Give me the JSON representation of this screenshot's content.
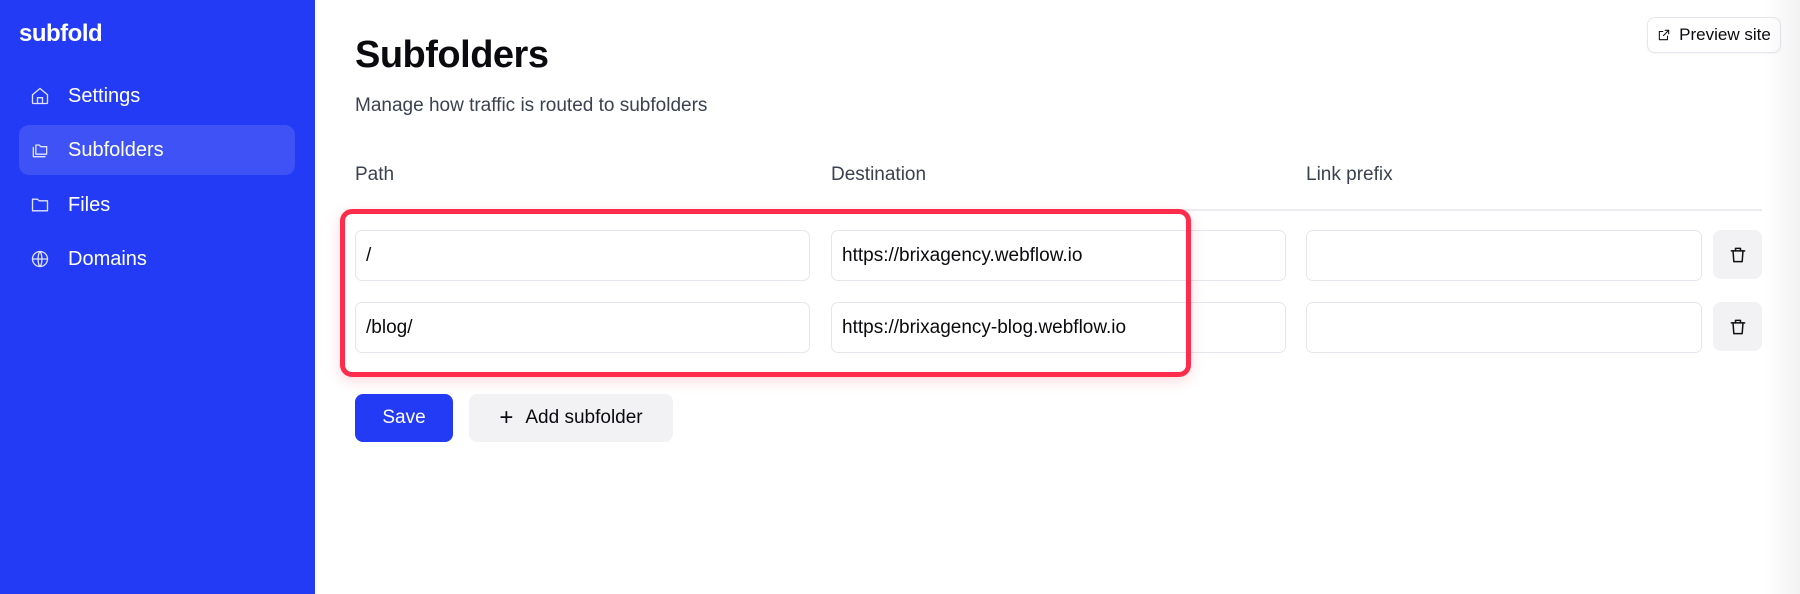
{
  "app": {
    "logo": "subfold"
  },
  "sidebar": {
    "items": [
      {
        "label": "Settings",
        "icon": "home-icon",
        "active": false
      },
      {
        "label": "Subfolders",
        "icon": "folders-icon",
        "active": true
      },
      {
        "label": "Files",
        "icon": "folder-icon",
        "active": false
      },
      {
        "label": "Domains",
        "icon": "globe-icon",
        "active": false
      }
    ]
  },
  "header": {
    "title": "Subfolders",
    "subtitle": "Manage how traffic is routed to subfolders",
    "preview_label": "Preview site"
  },
  "table": {
    "columns": [
      "Path",
      "Destination",
      "Link prefix"
    ],
    "rows": [
      {
        "path": "/",
        "destination": "https://brixagency.webflow.io",
        "link_prefix": ""
      },
      {
        "path": "/blog/",
        "destination": "https://brixagency-blog.webflow.io",
        "link_prefix": ""
      }
    ]
  },
  "actions": {
    "save_label": "Save",
    "add_label": "Add subfolder"
  },
  "colors": {
    "brand": "#243bf5",
    "highlight": "#ff2d4b"
  }
}
